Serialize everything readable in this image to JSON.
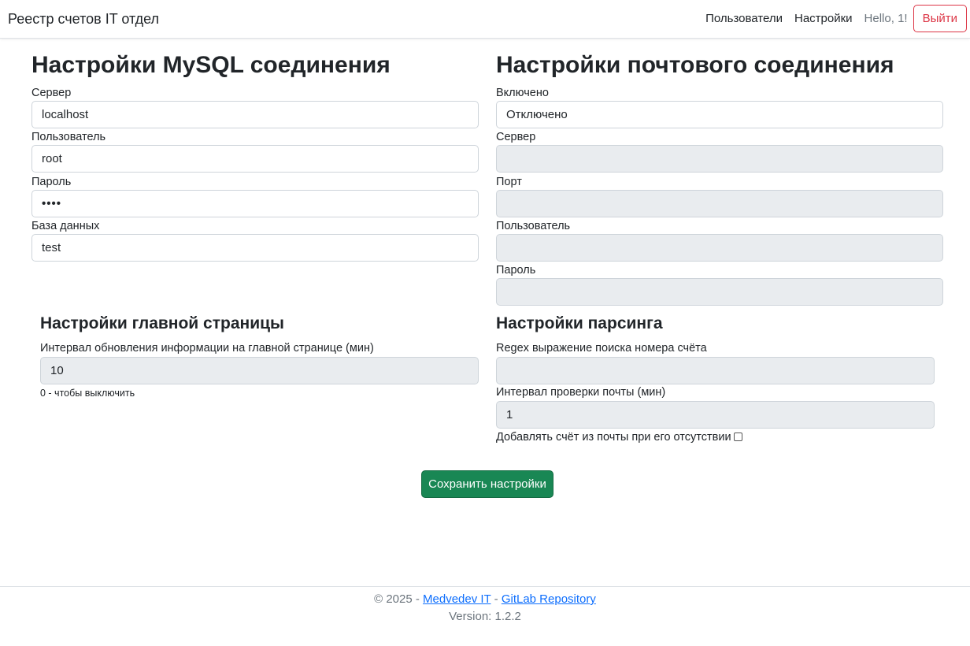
{
  "navbar": {
    "brand": "Реестр счетов IT отдел",
    "links": [
      "Пользователи",
      "Настройки"
    ],
    "hello": "Hello, 1!",
    "logout_label": "Выйти"
  },
  "mysql": {
    "title": "Настройки MySQL соединения",
    "server_label": "Сервер",
    "server_value": "localhost",
    "user_label": "Пользователь",
    "user_value": "root",
    "password_label": "Пароль",
    "password_value": "••••",
    "db_label": "База данных",
    "db_value": "test"
  },
  "mail": {
    "title": "Настройки почтового соединения",
    "enabled_label": "Включено",
    "enabled_value": "Отключено",
    "server_label": "Сервер",
    "server_value": "",
    "port_label": "Порт",
    "port_value": "",
    "user_label": "Пользователь",
    "user_value": "",
    "password_label": "Пароль",
    "password_value": ""
  },
  "main_page": {
    "title": "Настройки главной страницы",
    "interval_label": "Интервал обновления информации на главной странице (мин)",
    "interval_value": "10",
    "interval_hint": "0 - чтобы выключить"
  },
  "parsing": {
    "title": "Настройки парсинга",
    "regex_label": "Regex выражение поиска номера счёта",
    "regex_value": "",
    "check_interval_label": "Интервал проверки почты (мин)",
    "check_interval_value": "1",
    "add_invoice_label": "Добавлять счёт из почты при его отсутствии",
    "add_invoice_checked": false
  },
  "save_label": "Сохранить настройки",
  "footer": {
    "copyright": "© 2025 - ",
    "link1": "Medvedev IT",
    "separator": " - ",
    "link2": "GitLab Repository",
    "version": "Version: 1.2.2"
  }
}
